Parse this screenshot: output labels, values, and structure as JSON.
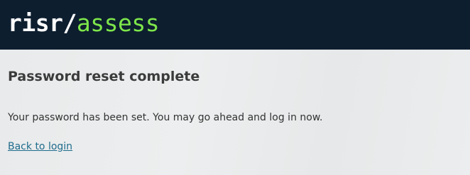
{
  "header": {
    "logo_brand": "risr",
    "logo_slash": "/",
    "logo_product": "assess"
  },
  "main": {
    "title": "Password reset complete",
    "message": "Your password has been set. You may go ahead and log in now.",
    "back_link": "Back to login"
  },
  "colors": {
    "header_bg": "#0d1e2f",
    "logo_accent": "#7ee64a",
    "link": "#1f6c8c",
    "page_bg": "#e9ebec"
  }
}
